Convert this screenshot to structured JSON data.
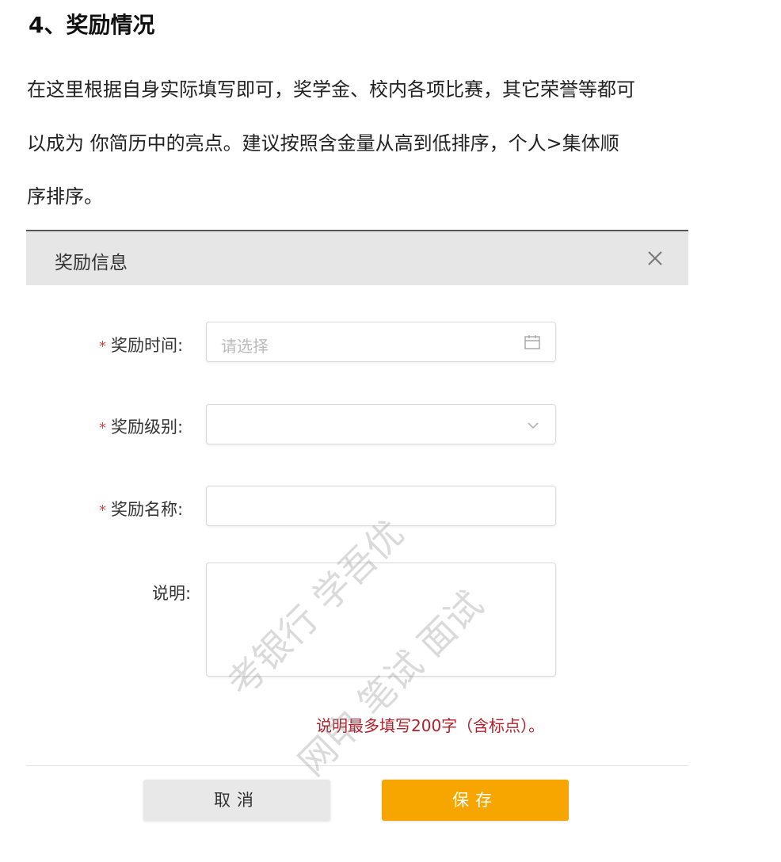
{
  "heading": "4、奖励情况",
  "paragraph_lines": [
    "在这里根据自身实际填写即可，奖学金、校内各项比赛，其它荣誉等都可",
    "以成为 你简历中的亮点。建议按照含金量从高到低排序，个人>集体顺",
    "序排序。"
  ],
  "dialog": {
    "title": "奖励信息",
    "required_mark": "*",
    "fields": {
      "time": {
        "label": "奖励时间:",
        "placeholder": "请选择"
      },
      "level": {
        "label": "奖励级别:"
      },
      "name": {
        "label": "奖励名称:"
      },
      "desc": {
        "label": "说明:"
      }
    },
    "hint": "说明最多填写200字（含标点）。",
    "cancel_label": "取消",
    "save_label": "保存"
  },
  "watermark": {
    "line1": "考银行 学吾优",
    "line2": "网申 笔试 面试"
  },
  "colors": {
    "header_bg": "#e6e6e6",
    "required": "#e0403c",
    "hint": "#b3202a",
    "save_button": "#f7a600",
    "cancel_button": "#e8e8e8"
  },
  "icons": {
    "close": "close-icon",
    "calendar": "calendar-icon",
    "dropdown": "chevron-down-icon"
  }
}
